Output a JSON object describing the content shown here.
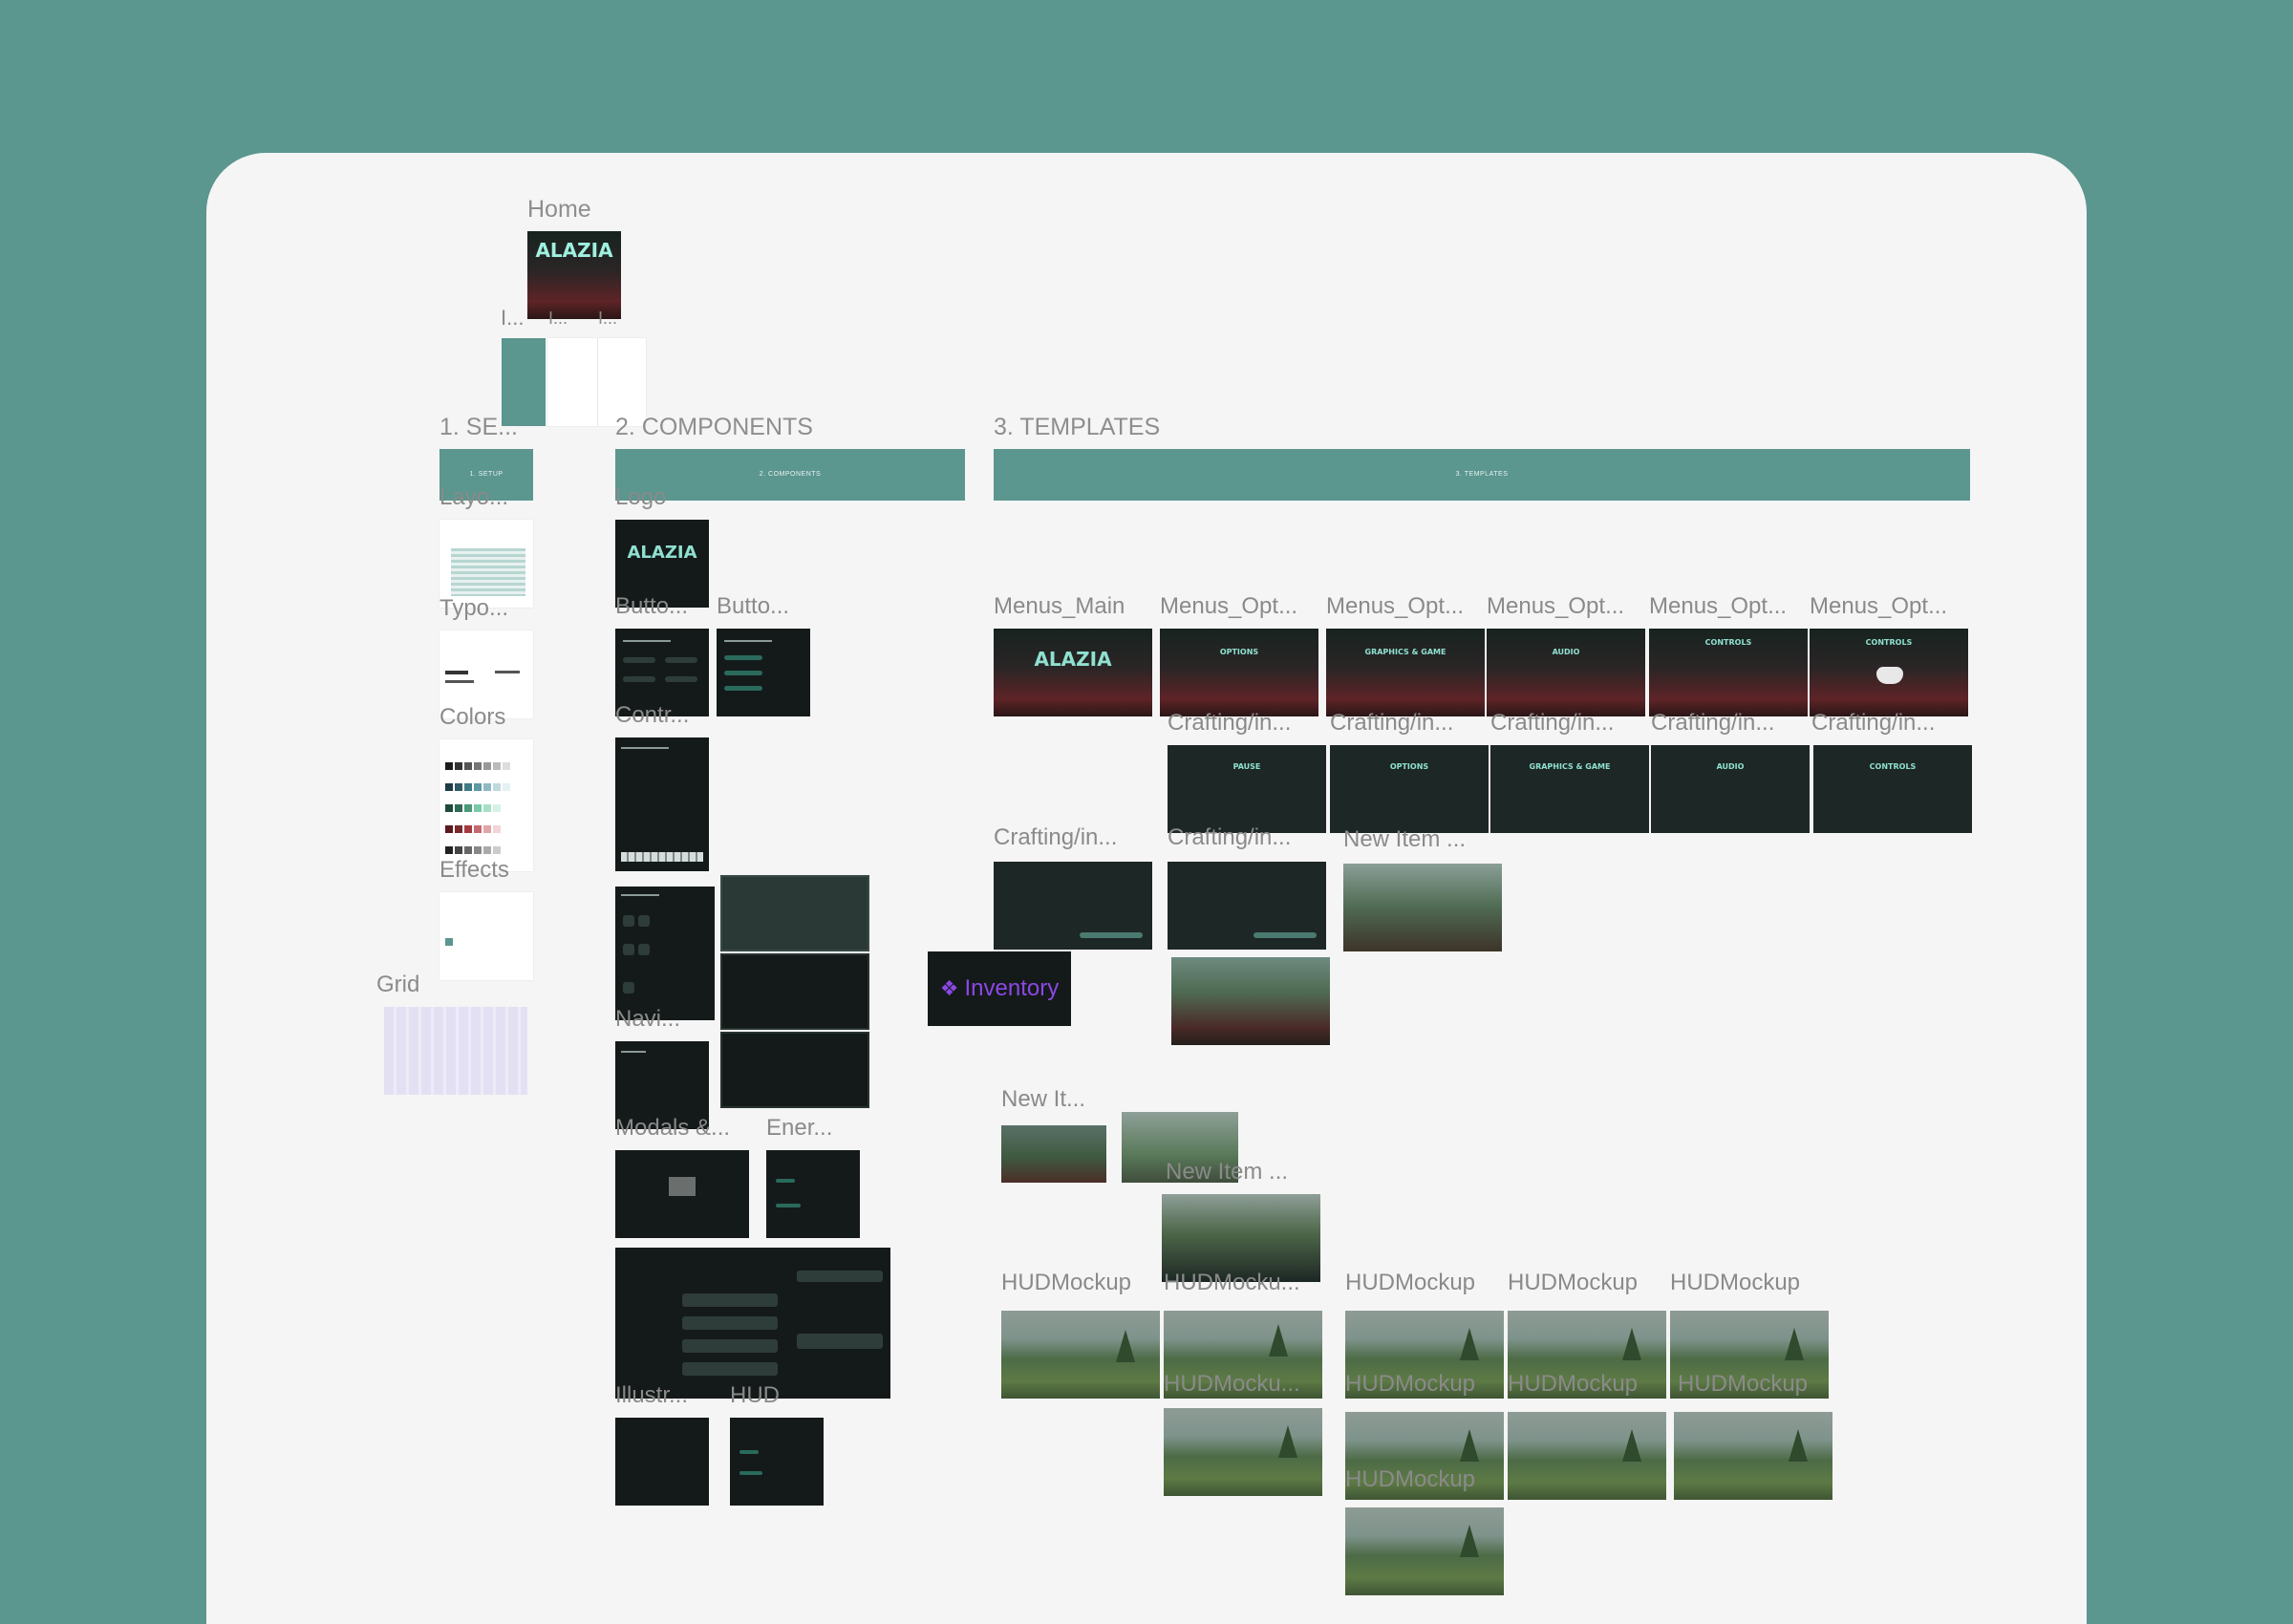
{
  "colors": {
    "backdrop": "#5b968f",
    "canvas": "#f5f5f5",
    "section_bar": "#5b968f",
    "accent_purple": "#8c48e6",
    "accent_teal": "#8fe0d0"
  },
  "pages": {
    "home": "Home",
    "home_sub": "I...",
    "home_sub2": "I...",
    "home_sub3": "I..."
  },
  "sections": {
    "setup": {
      "label": "1. SE...",
      "bar": "1. SETUP"
    },
    "components": {
      "label": "2. COMPONENTS",
      "bar": "2. COMPONENTS"
    },
    "templates": {
      "label": "3. TEMPLATES",
      "bar": "3. TEMPLATES"
    }
  },
  "setup_frames": {
    "layout": "Layo...",
    "typography": "Typo...",
    "colors": "Colors",
    "effects": "Effects",
    "grid": "Grid"
  },
  "component_frames": {
    "logo": "Logo",
    "buttons1": "Butto...",
    "buttons2": "Butto...",
    "controls": "Contr...",
    "navigation": "Navi...",
    "modals": "Modals &...",
    "energy": "Ener...",
    "illustrations": "Illustr...",
    "hud": "HUD"
  },
  "inventory_component": {
    "icon": "component-diamond-icon",
    "label": "Inventory"
  },
  "logo_text": "ALAZIA",
  "template_frames": {
    "menus": [
      "Menus_Main",
      "Menus_Opt...",
      "Menus_Opt...",
      "Menus_Opt...",
      "Menus_Opt...",
      "Menus_Opt..."
    ],
    "menu_titles": [
      "OPTIONS",
      "GRAPHICS & GAME",
      "AUDIO",
      "CONTROLS",
      "CONTROLS"
    ],
    "crafting_row": [
      "Crafting/in...",
      "Crafting/in...",
      "Crafting/in...",
      "Crafting/in...",
      "Crafting/in..."
    ],
    "crafting_titles": [
      "PAUSE",
      "OPTIONS",
      "GRAPHICS & GAME",
      "AUDIO",
      "CONTROLS"
    ],
    "crafting_left": "Crafting/in...",
    "crafting_mid": "Crafting/in...",
    "new_item_1": "New Item ...",
    "new_item_2": "New It...",
    "new_item_3": "New Item ...",
    "hud_labels": [
      "HUDMockup",
      "HUDMocku...",
      "HUDMockup",
      "HUDMockup",
      "HUDMockup"
    ],
    "hud_labels_row2": [
      "HUDMocku...",
      "HUDMockup",
      "HUDMockup",
      "HUDMockup"
    ],
    "hud_label_row3": "HUDMockup"
  }
}
